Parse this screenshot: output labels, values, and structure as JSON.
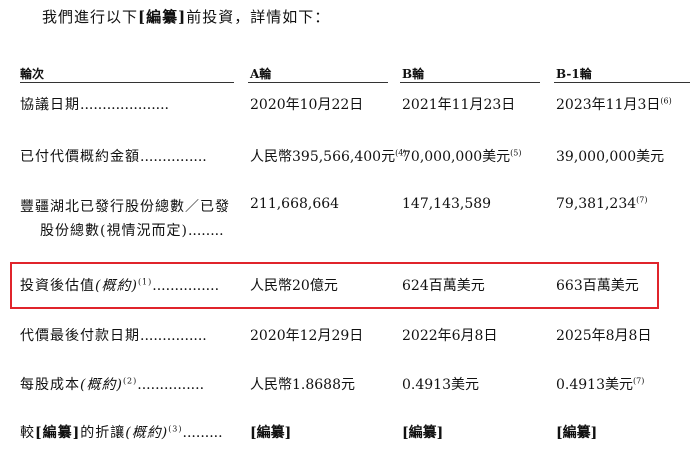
{
  "intro": {
    "prefix": "我們進行以下",
    "redacted": "[編纂]",
    "suffix": "前投資，詳情如下："
  },
  "header": {
    "col0": "輪次",
    "col1": "A輪",
    "col2": "B輪",
    "col3": "B-1輪"
  },
  "rows": [
    {
      "label": "協議日期",
      "dots": "....................",
      "a": "2020年10月22日",
      "a_sup": "",
      "b": "2021年11月23日",
      "b_sup": "",
      "c": "2023年11月3日",
      "c_sup": "(6)"
    },
    {
      "label": "已付代價概約金額",
      "dots": "...............",
      "a": "人民幣395,566,400元",
      "a_sup": "(4)",
      "b": "70,000,000美元",
      "b_sup": "(5)",
      "c": "39,000,000美元",
      "c_sup": ""
    },
    {
      "label_line1": "豐疆湖北已發行股份總數／已發",
      "label_line2": "股份總數(視情況而定)",
      "dots": "........",
      "a": "211,668,664",
      "a_sup": "",
      "b": "147,143,589",
      "b_sup": "",
      "c": "79,381,234",
      "c_sup": "(7)"
    },
    {
      "label_main": "投資後估值",
      "label_ital": "(概約)",
      "label_sup": "(1)",
      "dots": "...............",
      "a": "人民幣20億元",
      "a_sup": "",
      "b": "624百萬美元",
      "b_sup": "",
      "c": "663百萬美元",
      "c_sup": ""
    },
    {
      "label": "代價最後付款日期",
      "dots": "...............",
      "a": "2020年12月29日",
      "a_sup": "",
      "b": "2022年6月8日",
      "b_sup": "",
      "c": "2025年8月8日",
      "c_sup": ""
    },
    {
      "label_main": "每股成本",
      "label_ital": "(概約)",
      "label_sup": "(2)",
      "dots": "...............",
      "a": "人民幣1.8688元",
      "a_sup": "",
      "b": "0.4913美元",
      "b_sup": "",
      "c": "0.4913美元",
      "c_sup": "(7)"
    },
    {
      "label_pre": "較",
      "label_redacted": "[編纂]",
      "label_mid": "的折讓",
      "label_ital": "(概約)",
      "label_sup": "(3)",
      "dots": ".........",
      "a": "[編纂]",
      "a_sup": "",
      "b": "[編纂]",
      "b_sup": "",
      "c": "[編纂]",
      "c_sup": ""
    }
  ],
  "highlight_color": "#e0242b"
}
